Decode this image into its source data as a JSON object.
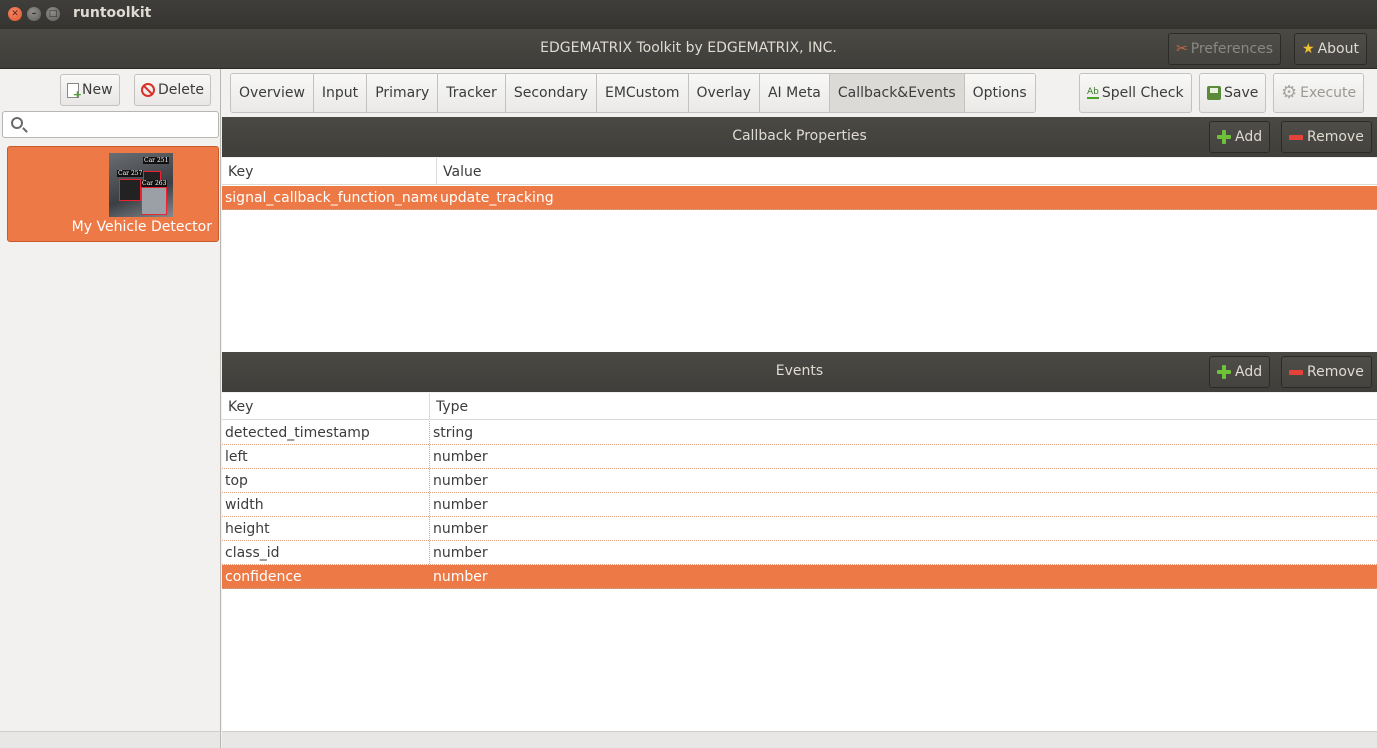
{
  "window": {
    "title": "runtoolkit"
  },
  "header": {
    "app_title": "EDGEMATRIX Toolkit by EDGEMATRIX, INC.",
    "preferences_label": "Preferences",
    "about_label": "About"
  },
  "sidebar": {
    "new_label": "New",
    "delete_label": "Delete",
    "search_placeholder": "",
    "items": [
      {
        "label": "My Vehicle Detector",
        "thumb_labels": [
          "Car 251",
          "Car 257",
          "Car 263"
        ]
      }
    ]
  },
  "tabs": [
    {
      "label": "Overview"
    },
    {
      "label": "Input"
    },
    {
      "label": "Primary"
    },
    {
      "label": "Tracker"
    },
    {
      "label": "Secondary"
    },
    {
      "label": "EMCustom"
    },
    {
      "label": "Overlay"
    },
    {
      "label": "AI Meta"
    },
    {
      "label": "Callback&Events"
    },
    {
      "label": "Options"
    }
  ],
  "toolbar": {
    "spellcheck_label": "Spell Check",
    "save_label": "Save",
    "execute_label": "Execute",
    "spellcheck_icon_text": "Ab"
  },
  "callback": {
    "title": "Callback Properties",
    "add_label": "Add",
    "remove_label": "Remove",
    "columns": [
      "Key",
      "Value"
    ],
    "rows": [
      {
        "key": "signal_callback_function_name",
        "value": "update_tracking"
      }
    ]
  },
  "events": {
    "title": "Events",
    "add_label": "Add",
    "remove_label": "Remove",
    "columns": [
      "Key",
      "Type"
    ],
    "rows": [
      {
        "key": "detected_timestamp",
        "type": "string"
      },
      {
        "key": "left",
        "type": "number"
      },
      {
        "key": "top",
        "type": "number"
      },
      {
        "key": "width",
        "type": "number"
      },
      {
        "key": "height",
        "type": "number"
      },
      {
        "key": "class_id",
        "type": "number"
      },
      {
        "key": "confidence",
        "type": "number"
      }
    ]
  },
  "colors": {
    "accent": "#ed7a46",
    "dark_header": "#3f3e3a",
    "add_green": "#6fc13a",
    "remove_red": "#e5433a"
  }
}
